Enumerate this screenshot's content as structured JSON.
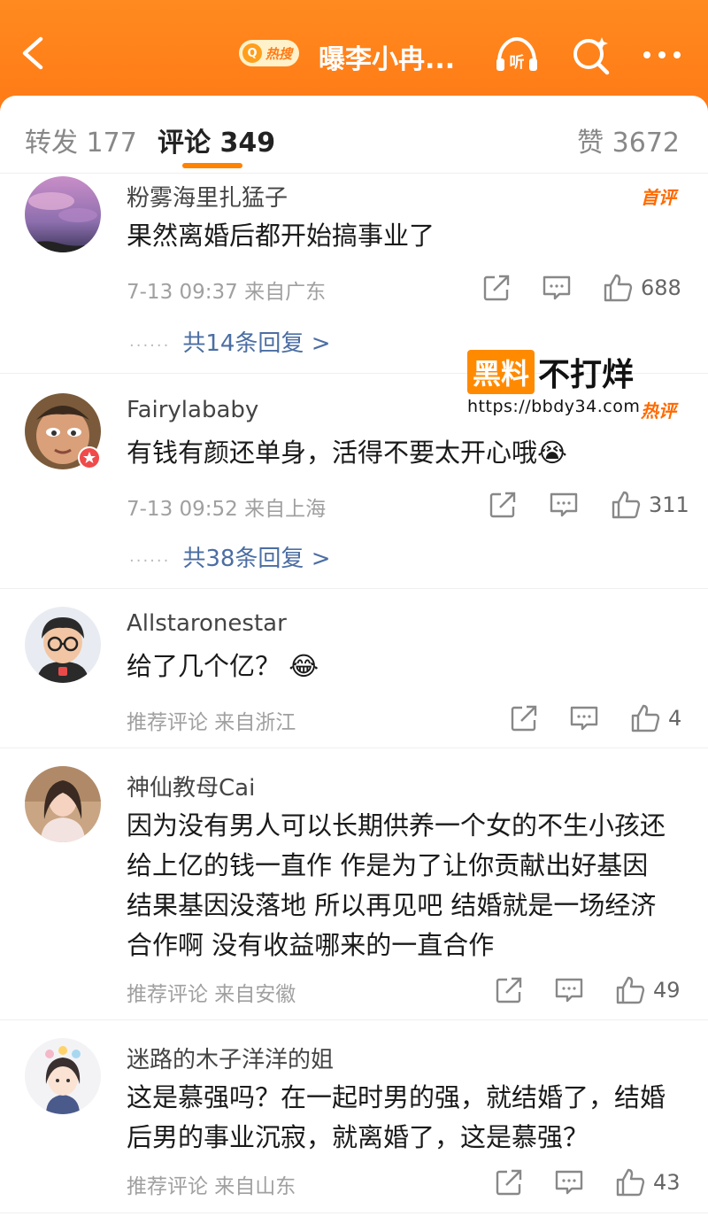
{
  "header": {
    "hot_search_tag": "热搜",
    "topic_title": "曝李小冉...",
    "colors": {
      "accent": "#ff8200",
      "topbar": "#ff7a16"
    }
  },
  "tabs": {
    "repost": "转发 177",
    "comments": "评论 349",
    "likes": "赞 3672"
  },
  "watermark": {
    "tag": "黑料",
    "text": "不打烊",
    "url": "https://bbdy34.com"
  },
  "comments": [
    {
      "name": "粉雾海里扎猛子",
      "text": "果然离婚后都开始搞事业了",
      "meta": "7-13 09:37  来自广东",
      "badge": "首评",
      "likes": "688",
      "replies": "共14条回复 >",
      "replies_dots": "······"
    },
    {
      "name": "Fairylababy",
      "text": "有钱有颜还单身，活得不要太开心哦😭",
      "meta": "7-13 09:52  来自上海",
      "badge": "热评",
      "likes": "311",
      "replies": "共38条回复 >",
      "replies_dots": "······"
    },
    {
      "name": "Allstaronestar",
      "text": "给了几个亿？ 😂",
      "meta": "推荐评论  来自浙江",
      "likes": "4"
    },
    {
      "name": "神仙教母Cai",
      "text": "因为没有男人可以长期供养一个女的不生小孩还给上亿的钱一直作 作是为了让你贡献出好基因 结果基因没落地 所以再见吧 结婚就是一场经济合作啊 没有收益哪来的一直合作",
      "meta": "推荐评论  来自安徽",
      "likes": "49"
    },
    {
      "name": "迷路的木子洋洋的姐",
      "text": "这是慕强吗？在一起时男的强，就结婚了，结婚后男的事业沉寂，就离婚了，这是慕强？",
      "meta": "推荐评论  来自山东",
      "likes": "43"
    }
  ]
}
